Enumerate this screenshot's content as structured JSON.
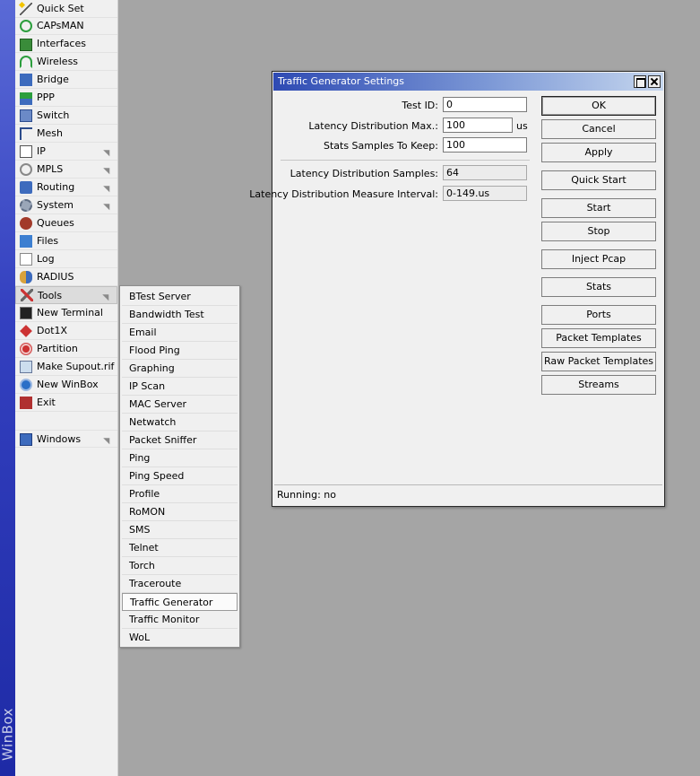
{
  "brand": "WinBox",
  "main_menu": {
    "items": [
      {
        "label": "Quick Set",
        "icon": "wand-icon"
      },
      {
        "label": "CAPsMAN",
        "icon": "capsman-icon"
      },
      {
        "label": "Interfaces",
        "icon": "interfaces-icon"
      },
      {
        "label": "Wireless",
        "icon": "wireless-icon"
      },
      {
        "label": "Bridge",
        "icon": "bridge-icon"
      },
      {
        "label": "PPP",
        "icon": "ppp-icon"
      },
      {
        "label": "Switch",
        "icon": "switch-icon"
      },
      {
        "label": "Mesh",
        "icon": "mesh-icon"
      },
      {
        "label": "IP",
        "icon": "ip-icon"
      },
      {
        "label": "MPLS",
        "icon": "mpls-icon"
      },
      {
        "label": "Routing",
        "icon": "routing-icon"
      },
      {
        "label": "System",
        "icon": "system-icon"
      },
      {
        "label": "Queues",
        "icon": "queues-icon"
      },
      {
        "label": "Files",
        "icon": "files-icon"
      },
      {
        "label": "Log",
        "icon": "log-icon"
      },
      {
        "label": "RADIUS",
        "icon": "radius-icon"
      },
      {
        "label": "Tools",
        "icon": "tools-icon"
      },
      {
        "label": "New Terminal",
        "icon": "terminal-icon"
      },
      {
        "label": "Dot1X",
        "icon": "dot1x-icon"
      },
      {
        "label": "Partition",
        "icon": "partition-icon"
      },
      {
        "label": "Make Supout.rif",
        "icon": "supout-icon"
      },
      {
        "label": "New WinBox",
        "icon": "winbox-icon"
      },
      {
        "label": "Exit",
        "icon": "exit-icon"
      },
      {
        "label": "Windows",
        "icon": "windows-icon"
      }
    ]
  },
  "tools_submenu": {
    "items": [
      "BTest Server",
      "Bandwidth Test",
      "Email",
      "Flood Ping",
      "Graphing",
      "IP Scan",
      "MAC Server",
      "Netwatch",
      "Packet Sniffer",
      "Ping",
      "Ping Speed",
      "Profile",
      "RoMON",
      "SMS",
      "Telnet",
      "Torch",
      "Traceroute",
      "Traffic Generator",
      "Traffic Monitor",
      "WoL"
    ],
    "selected": "Traffic Generator"
  },
  "dialog": {
    "title": "Traffic Generator Settings",
    "fields": {
      "test_id": {
        "label": "Test ID:",
        "value": "0"
      },
      "latency_max": {
        "label": "Latency Distribution Max.:",
        "value": "100",
        "unit": "us"
      },
      "stats_samples": {
        "label": "Stats Samples To Keep:",
        "value": "100"
      },
      "latency_samples": {
        "label": "Latency Distribution Samples:",
        "value": "64"
      },
      "latency_interval": {
        "label": "Latency Distribution Measure Interval:",
        "value": "0-149.us"
      }
    },
    "buttons": {
      "ok": "OK",
      "cancel": "Cancel",
      "apply": "Apply",
      "quick_start": "Quick Start",
      "start": "Start",
      "stop": "Stop",
      "inject_pcap": "Inject Pcap",
      "stats": "Stats",
      "ports": "Ports",
      "packet_templates": "Packet Templates",
      "raw_packet_templates": "Raw Packet Templates",
      "streams": "Streams"
    },
    "status": "Running: no"
  }
}
